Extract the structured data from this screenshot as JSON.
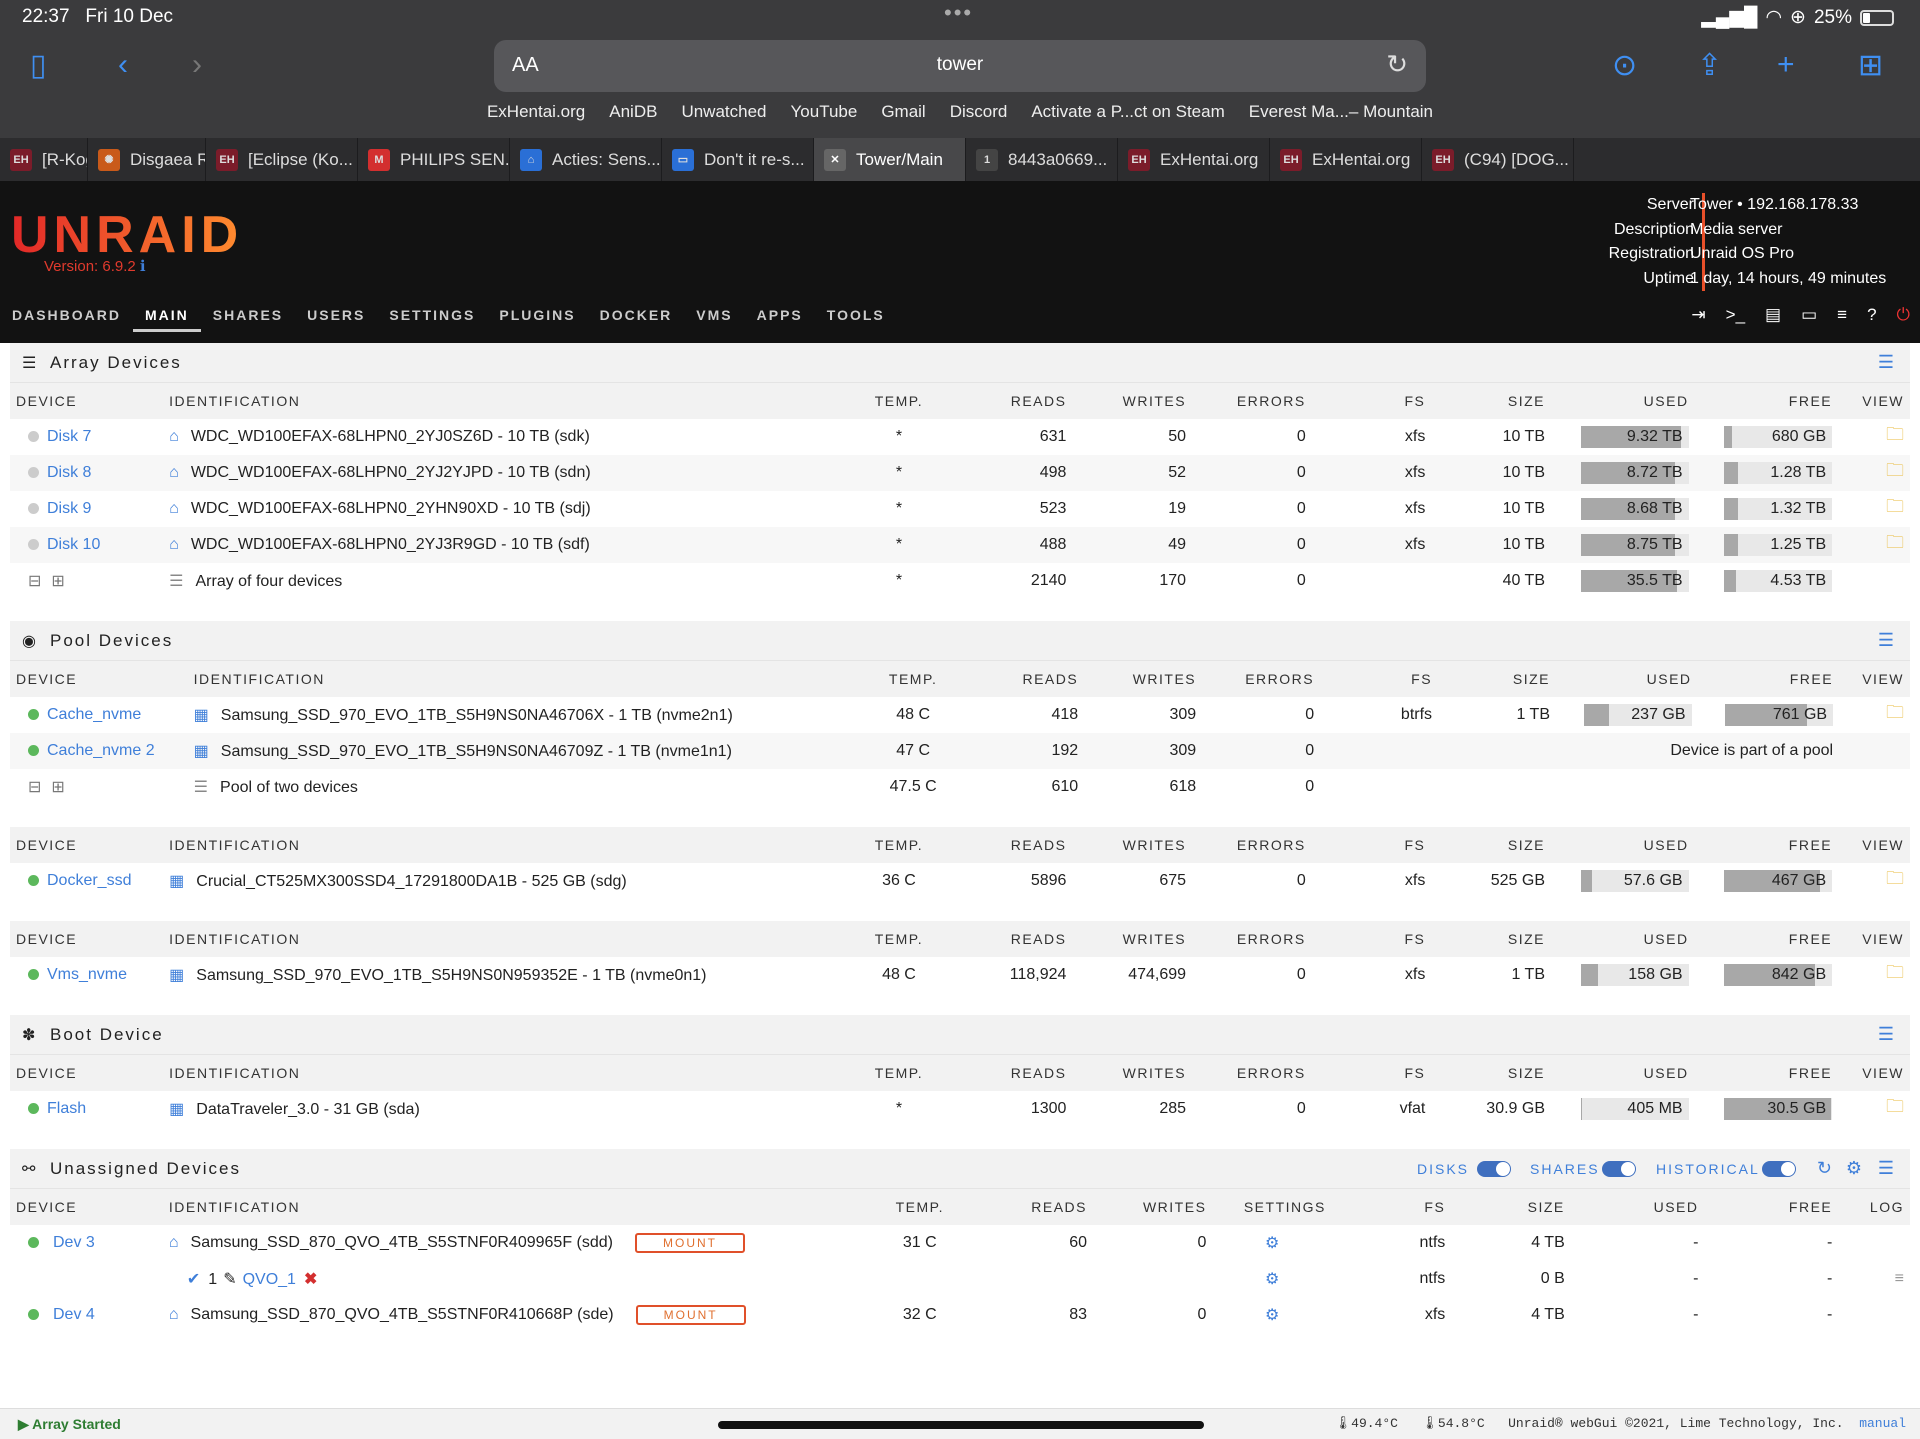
{
  "status_bar": {
    "time": "22:37",
    "date": "Fri 10 Dec",
    "battery": "25%",
    "battery_level": 0.25
  },
  "safari": {
    "address": "tower",
    "aa_label": "AA",
    "favorites": [
      "ExHentai.org",
      "AniDB",
      "Unwatched",
      "YouTube",
      "Gmail",
      "Discord",
      "Activate a P...ct on Steam",
      "Everest Ma...– Mountain"
    ],
    "tabs": [
      {
        "label": "[R-Kog",
        "icon": "EH",
        "color": "#7b1c2a"
      },
      {
        "label": "Disgaea RP",
        "icon": "✺",
        "color": "#c95a1a"
      },
      {
        "label": "[Eclipse (Ko...",
        "icon": "EH",
        "color": "#7b1c2a"
      },
      {
        "label": "PHILIPS SEN...",
        "icon": "M",
        "color": "#d32f2f"
      },
      {
        "label": "Acties: Sens...",
        "icon": "⌂",
        "color": "#2a6fd6"
      },
      {
        "label": "Don't it re-s...",
        "icon": "▭",
        "color": "#2a6fd6"
      },
      {
        "label": "Tower/Main",
        "icon": "✕",
        "color": "#666",
        "active": true
      },
      {
        "label": "8443a0669...",
        "icon": "1",
        "color": "#444"
      },
      {
        "label": "ExHentai.org",
        "icon": "EH",
        "color": "#7b1c2a"
      },
      {
        "label": "ExHentai.org",
        "icon": "EH",
        "color": "#7b1c2a"
      },
      {
        "label": "(C94) [DOG...",
        "icon": "EH",
        "color": "#7b1c2a"
      }
    ]
  },
  "header": {
    "logo": "UNRAID",
    "version": "Version: 6.9.2",
    "info_icon": "ℹ",
    "server_keys": [
      "Server",
      "Description",
      "Registration",
      "Uptime"
    ],
    "server_vals": [
      "Tower • 192.168.178.33",
      "Media server",
      "Unraid OS Pro",
      "1 day, 14 hours, 49 minutes"
    ],
    "nav": [
      "DASHBOARD",
      "MAIN",
      "SHARES",
      "USERS",
      "SETTINGS",
      "PLUGINS",
      "DOCKER",
      "VMS",
      "APPS",
      "TOOLS"
    ],
    "active_nav": "MAIN"
  },
  "columns": [
    "DEVICE",
    "IDENTIFICATION",
    "TEMP.",
    "READS",
    "WRITES",
    "ERRORS",
    "FS",
    "SIZE",
    "USED",
    "FREE",
    "VIEW"
  ],
  "array": {
    "title": "Array Devices",
    "rows": [
      {
        "device": "Disk 7",
        "id": "WDC_WD100EFAX-68LHPN0_2YJ0SZ6D - 10 TB (sdk)",
        "temp": "*",
        "reads": "631",
        "writes": "50",
        "errors": "0",
        "fs": "xfs",
        "size": "10 TB",
        "used": "9.32 TB",
        "free": "680 GB",
        "used_pct": 93,
        "free_pct": 7
      },
      {
        "device": "Disk 8",
        "id": "WDC_WD100EFAX-68LHPN0_2YJ2YJPD - 10 TB (sdn)",
        "temp": "*",
        "reads": "498",
        "writes": "52",
        "errors": "0",
        "fs": "xfs",
        "size": "10 TB",
        "used": "8.72 TB",
        "free": "1.28 TB",
        "used_pct": 87,
        "free_pct": 13
      },
      {
        "device": "Disk 9",
        "id": "WDC_WD100EFAX-68LHPN0_2YHN90XD - 10 TB (sdj)",
        "temp": "*",
        "reads": "523",
        "writes": "19",
        "errors": "0",
        "fs": "xfs",
        "size": "10 TB",
        "used": "8.68 TB",
        "free": "1.32 TB",
        "used_pct": 87,
        "free_pct": 13
      },
      {
        "device": "Disk 10",
        "id": "WDC_WD100EFAX-68LHPN0_2YJ3R9GD - 10 TB (sdf)",
        "temp": "*",
        "reads": "488",
        "writes": "49",
        "errors": "0",
        "fs": "xfs",
        "size": "10 TB",
        "used": "8.75 TB",
        "free": "1.25 TB",
        "used_pct": 87,
        "free_pct": 13
      }
    ],
    "summary": {
      "id": "Array of four devices",
      "temp": "*",
      "reads": "2140",
      "writes": "170",
      "errors": "0",
      "size": "40 TB",
      "used": "35.5 TB",
      "free": "4.53 TB",
      "used_pct": 89,
      "free_pct": 11
    }
  },
  "pool": {
    "title": "Pool Devices",
    "cache": [
      {
        "device": "Cache_nvme",
        "id": "Samsung_SSD_970_EVO_1TB_S5H9NS0NA46706X - 1 TB (nvme2n1)",
        "temp": "48 C",
        "reads": "418",
        "writes": "309",
        "errors": "0",
        "fs": "btrfs",
        "size": "1 TB",
        "used": "237 GB",
        "free": "761 GB",
        "used_pct": 24,
        "free_pct": 76
      },
      {
        "device": "Cache_nvme 2",
        "id": "Samsung_SSD_970_EVO_1TB_S5H9NS0NA46709Z - 1 TB (nvme1n1)",
        "temp": "47 C",
        "reads": "192",
        "writes": "309",
        "errors": "0",
        "note": "Device is part of a pool"
      }
    ],
    "summary": {
      "id": "Pool of two devices",
      "temp": "47.5 C",
      "reads": "610",
      "writes": "618",
      "errors": "0"
    },
    "docker": {
      "device": "Docker_ssd",
      "id": "Crucial_CT525MX300SSD4_17291800DA1B - 525 GB (sdg)",
      "temp": "36 C",
      "reads": "5896",
      "writes": "675",
      "errors": "0",
      "fs": "xfs",
      "size": "525 GB",
      "used": "57.6 GB",
      "free": "467 GB",
      "used_pct": 11,
      "free_pct": 89
    },
    "vms": {
      "device": "Vms_nvme",
      "id": "Samsung_SSD_970_EVO_1TB_S5H9NS0N959352E - 1 TB (nvme0n1)",
      "temp": "48 C",
      "reads": "118,924",
      "writes": "474,699",
      "errors": "0",
      "fs": "xfs",
      "size": "1 TB",
      "used": "158 GB",
      "free": "842 GB",
      "used_pct": 16,
      "free_pct": 84
    }
  },
  "boot": {
    "title": "Boot Device",
    "row": {
      "device": "Flash",
      "id": "DataTraveler_3.0 - 31 GB (sda)",
      "temp": "*",
      "reads": "1300",
      "writes": "285",
      "errors": "0",
      "fs": "vfat",
      "size": "30.9 GB",
      "used": "405 MB",
      "free": "30.5 GB",
      "used_pct": 1,
      "free_pct": 99
    }
  },
  "unassigned": {
    "title": "Unassigned Devices",
    "toggles": [
      "DISKS",
      "SHARES",
      "HISTORICAL"
    ],
    "columns": [
      "DEVICE",
      "IDENTIFICATION",
      "TEMP.",
      "READS",
      "WRITES",
      "SETTINGS",
      "FS",
      "SIZE",
      "USED",
      "FREE",
      "LOG"
    ],
    "mount_label": "MOUNT",
    "rows": [
      {
        "device": "Dev 3",
        "id": "Samsung_SSD_870_QVO_4TB_S5STNF0R409965F (sdd)",
        "temp": "31 C",
        "reads": "60",
        "writes": "0",
        "fs": "ntfs",
        "size": "4 TB",
        "used": "-",
        "free": "-"
      },
      {
        "device": "Dev 4",
        "id": "Samsung_SSD_870_QVO_4TB_S5STNF0R410668P (sde)",
        "temp": "32 C",
        "reads": "83",
        "writes": "0",
        "fs": "xfs",
        "size": "4 TB",
        "used": "-",
        "free": "-"
      }
    ],
    "partition": {
      "num": "1",
      "name": "QVO_1",
      "fs": "ntfs",
      "size": "0 B",
      "used": "-",
      "free": "-"
    }
  },
  "footer": {
    "status": "Array Started",
    "temp1": "49.4°C",
    "temp2": "54.8°C",
    "copyright": "Unraid® webGui ©2021, Lime Technology, Inc.",
    "manual": "manual"
  }
}
